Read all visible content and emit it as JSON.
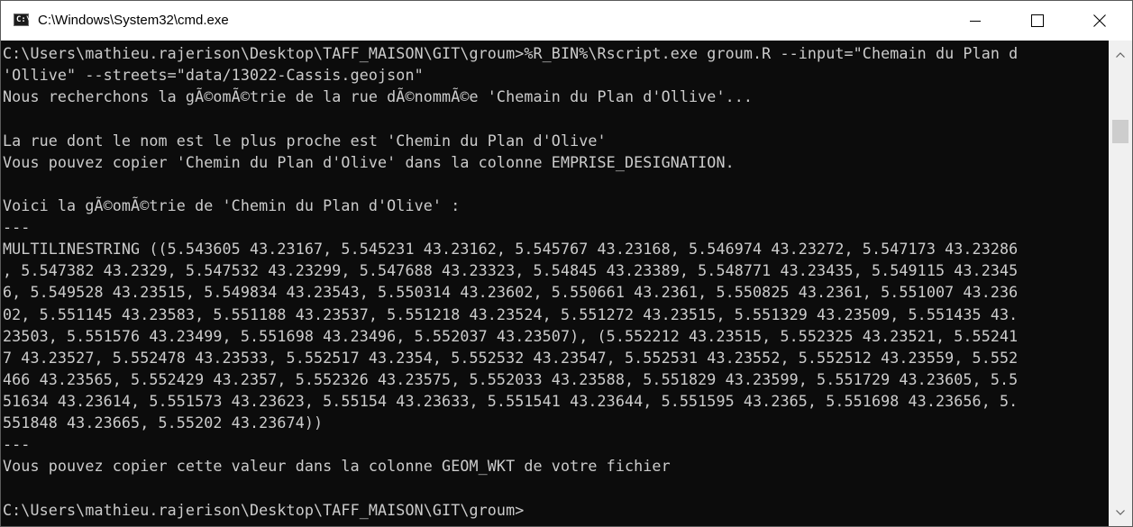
{
  "window": {
    "title": "C:\\Windows\\System32\\cmd.exe",
    "icon": "cmd-icon",
    "icon_glyph": "C:\\",
    "controls": {
      "minimize": "minimize-icon",
      "maximize": "maximize-icon",
      "close": "close-icon"
    }
  },
  "console": {
    "text_color": "#cccccc",
    "background": "#0c0c0c",
    "lines": [
      "C:\\Users\\mathieu.rajerison\\Desktop\\TAFF_MAISON\\GIT\\groum>%R_BIN%\\Rscript.exe groum.R --input=\"Chemain du Plan d",
      "'Ollive\" --streets=\"data/13022-Cassis.geojson\"",
      "Nous recherchons la gÃ©omÃ©trie de la rue dÃ©nommÃ©e 'Chemain du Plan d'Ollive'...",
      "",
      "La rue dont le nom est le plus proche est 'Chemin du Plan d'Olive'",
      "Vous pouvez copier 'Chemin du Plan d'Olive' dans la colonne EMPRISE_DESIGNATION.",
      "",
      "Voici la gÃ©omÃ©trie de 'Chemin du Plan d'Olive' :",
      "---",
      "MULTILINESTRING ((5.543605 43.23167, 5.545231 43.23162, 5.545767 43.23168, 5.546974 43.23272, 5.547173 43.23286",
      ", 5.547382 43.2329, 5.547532 43.23299, 5.547688 43.23323, 5.54845 43.23389, 5.548771 43.23435, 5.549115 43.2345",
      "6, 5.549528 43.23515, 5.549834 43.23543, 5.550314 43.23602, 5.550661 43.2361, 5.550825 43.2361, 5.551007 43.236",
      "02, 5.551145 43.23583, 5.551188 43.23537, 5.551218 43.23524, 5.551272 43.23515, 5.551329 43.23509, 5.551435 43.",
      "23503, 5.551576 43.23499, 5.551698 43.23496, 5.552037 43.23507), (5.552212 43.23515, 5.552325 43.23521, 5.55241",
      "7 43.23527, 5.552478 43.23533, 5.552517 43.2354, 5.552532 43.23547, 5.552531 43.23552, 5.552512 43.23559, 5.552",
      "466 43.23565, 5.552429 43.2357, 5.552326 43.23575, 5.552033 43.23588, 5.551829 43.23599, 5.551729 43.23605, 5.5",
      "51634 43.23614, 5.551573 43.23623, 5.55154 43.23633, 5.551541 43.23644, 5.551595 43.2365, 5.551698 43.23656, 5.",
      "551848 43.23665, 5.55202 43.23674))",
      "---",
      "Vous pouvez copier cette valeur dans la colonne GEOM_WKT de votre fichier",
      "",
      "C:\\Users\\mathieu.rajerison\\Desktop\\TAFF_MAISON\\GIT\\groum>"
    ]
  },
  "scrollbar": {
    "up_icon": "scroll-up-arrow-icon",
    "down_icon": "scroll-down-arrow-icon"
  }
}
